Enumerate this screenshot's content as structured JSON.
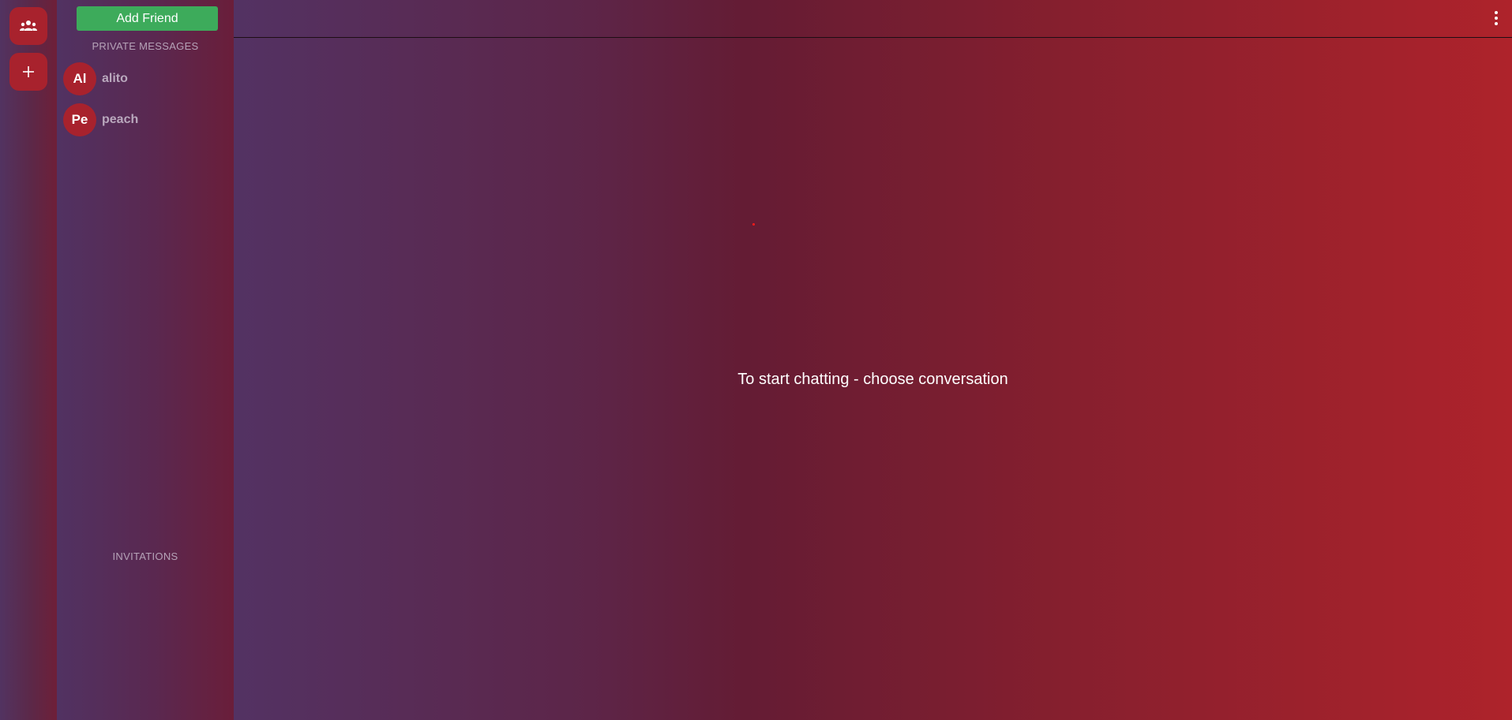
{
  "rail": {
    "friends_icon": "people-group-icon",
    "add_icon": "plus-icon"
  },
  "sidebar": {
    "add_friend_label": "Add Friend",
    "private_messages_title": "PRIVATE MESSAGES",
    "conversations": [
      {
        "initials": "Al",
        "name": "alito"
      },
      {
        "initials": "Pe",
        "name": "peach"
      }
    ],
    "invitations_title": "INVITATIONS"
  },
  "main": {
    "menu_icon": "more-vertical-icon",
    "empty_message": "To start chatting - choose conversation"
  },
  "colors": {
    "accent_red": "#a8222d",
    "add_friend_green": "#3dab5b"
  }
}
